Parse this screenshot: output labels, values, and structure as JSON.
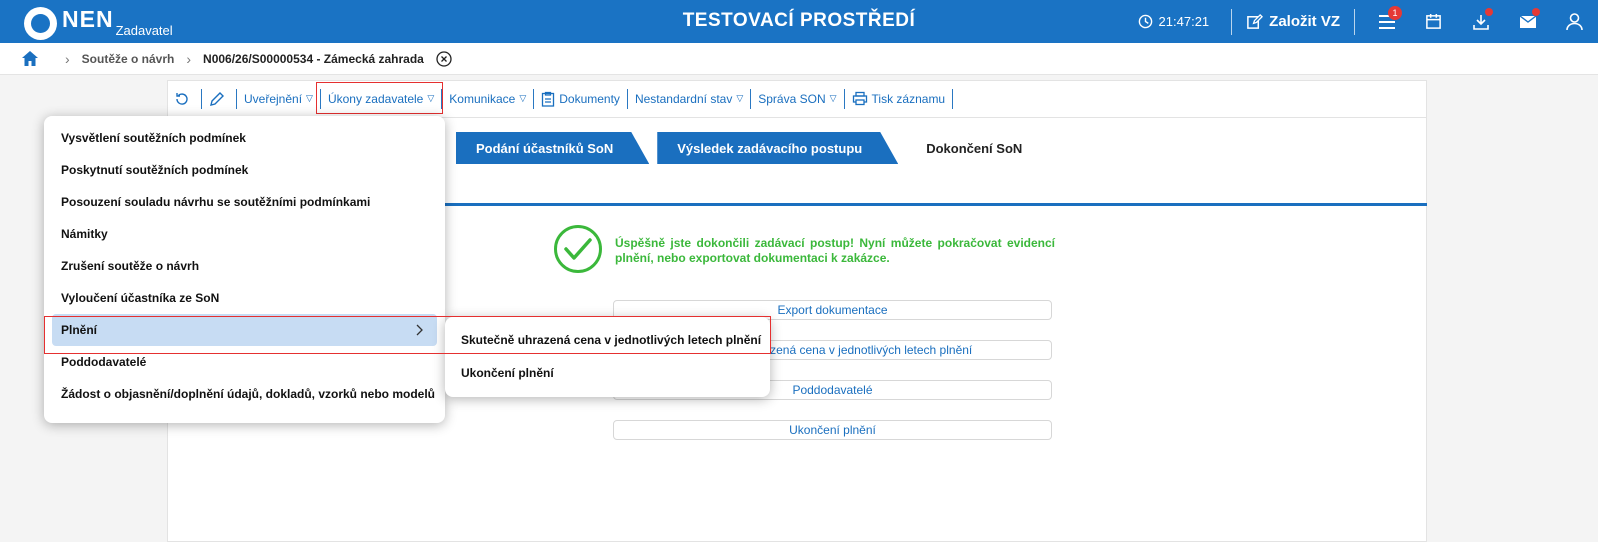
{
  "app": {
    "logo_text": "NEN",
    "logo_sub": "Zadavatel",
    "env_title": "TESTOVACÍ PROSTŘEDÍ",
    "clock": "21:47:21",
    "create_label": "Založit VZ",
    "menu_badge": "1"
  },
  "breadcrumb": {
    "items": [
      "Soutěže o návrh",
      "N006/26/S00000534 - Zámecká zahrada"
    ]
  },
  "toolbar": {
    "publish": "Uveřejnění",
    "actions": "Úkony zadavatele",
    "communication": "Komunikace",
    "documents": "Dokumenty",
    "nonstandard": "Nestandardní stav",
    "son_admin": "Správa SON",
    "print": "Tisk záznamu"
  },
  "tabs": [
    "Podání účastníků SoN",
    "Výsledek zadávacího postupu",
    "Dokončení SoN"
  ],
  "success": {
    "message": "Úspěšně jste dokončili zadávací postup! Nyní můžete pokračovat evidencí plnění, nebo exportovat dokumentaci k zakázce."
  },
  "actions": [
    "Export dokumentace",
    "Skutečně uhrazená cena v jednotlivých letech plnění",
    "Poddodavatelé",
    "Ukončení plnění"
  ],
  "menu": {
    "items": [
      "Vysvětlení soutěžních podmínek",
      "Poskytnutí soutěžních podmínek",
      "Posouzení souladu návrhu se soutěžními podmínkami",
      "Námitky",
      "Zrušení soutěže o návrh",
      "Vyloučení účastníka ze SoN",
      "Plnění",
      "Poddodavatelé",
      "Žádost o objasnění/doplnění údajů, dokladů, vzorků nebo modelů"
    ],
    "submenu": [
      "Skutečně uhrazená cena v jednotlivých letech plnění",
      "Ukončení plnění"
    ]
  },
  "colors": {
    "brand": "#1a73c4",
    "success": "#3bb83b",
    "highlight": "#e53030"
  }
}
